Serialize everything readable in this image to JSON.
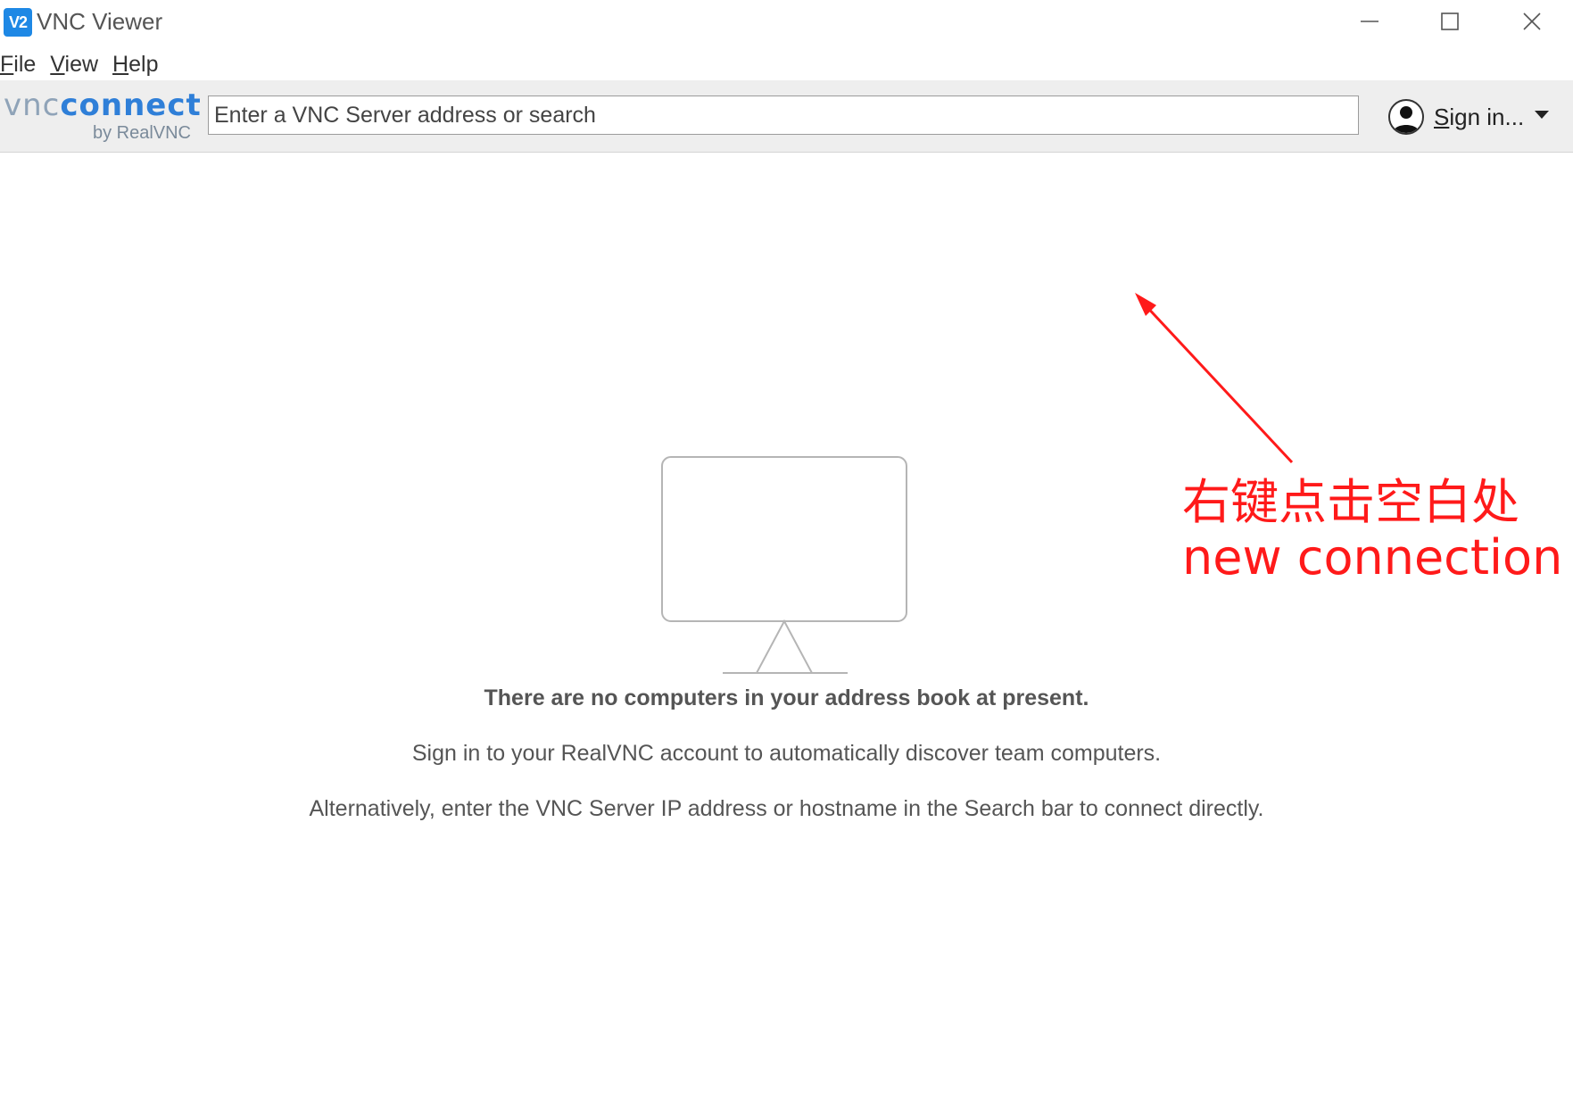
{
  "window": {
    "app_icon_text": "V2",
    "title": "VNC Viewer"
  },
  "menubar": {
    "items": [
      {
        "accel": "F",
        "rest": "ile"
      },
      {
        "accel": "V",
        "rest": "iew"
      },
      {
        "accel": "H",
        "rest": "elp"
      }
    ]
  },
  "toolbar": {
    "logo_vnc": "vnc",
    "logo_connect": "connect",
    "logo_by": "by RealVNC",
    "search_placeholder": "Enter a VNC Server address or search",
    "signin_accel": "S",
    "signin_rest": "ign in..."
  },
  "empty_state": {
    "heading": "There are no computers in your address book at present.",
    "line1": "Sign in to your RealVNC account to automatically discover team computers.",
    "line2": "Alternatively, enter the VNC Server IP address or hostname in the Search bar to connect directly."
  },
  "annotation": {
    "line1": "右键点击空白处",
    "line2": "new connection",
    "color": "#ff1a1a"
  },
  "colors": {
    "accent": "#1e88e5",
    "toolbar_bg": "#eeeeee",
    "text_muted": "#555555"
  }
}
